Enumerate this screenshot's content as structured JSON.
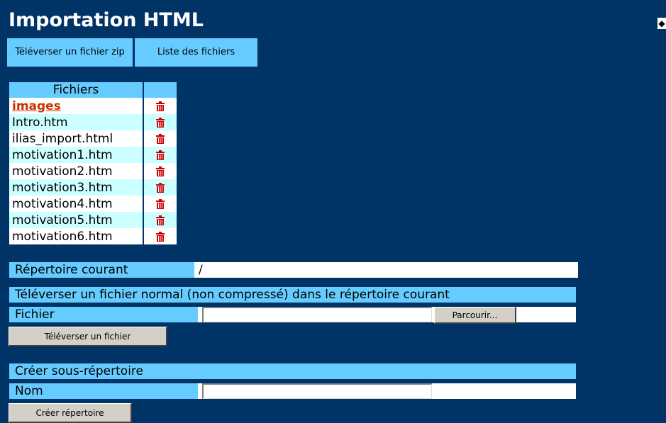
{
  "page": {
    "title": "Importation HTML"
  },
  "tabs": {
    "upload_zip": "Téléverser un fichier zip",
    "file_list": "Liste des fichiers"
  },
  "files_table": {
    "header": "Fichiers",
    "rows": [
      {
        "name": "images",
        "is_dir": true
      },
      {
        "name": "Intro.htm"
      },
      {
        "name": "ilias_import.html"
      },
      {
        "name": "motivation1.htm"
      },
      {
        "name": "motivation2.htm"
      },
      {
        "name": "motivation3.htm"
      },
      {
        "name": "motivation4.htm"
      },
      {
        "name": "motivation5.htm"
      },
      {
        "name": "motivation6.htm"
      }
    ],
    "delete_icon": "trash-icon"
  },
  "current_dir": {
    "label": "Répertoire courant",
    "value": "/"
  },
  "upload_file": {
    "header": "Téléverser un fichier normal (non compressé) dans le répertoire courant",
    "file_label": "Fichier",
    "file_value": "",
    "browse_label": "Parcourir...",
    "submit_label": "Téléverser un fichier"
  },
  "create_dir": {
    "header": "Créer sous-répertoire",
    "name_label": "Nom",
    "name_value": "",
    "submit_label": "Créer répertoire"
  },
  "colors": {
    "background": "#003366",
    "accent": "#66ccff",
    "row_alt": "#ccffff",
    "dir_link": "#cc3300",
    "trash": "#cc0000"
  }
}
